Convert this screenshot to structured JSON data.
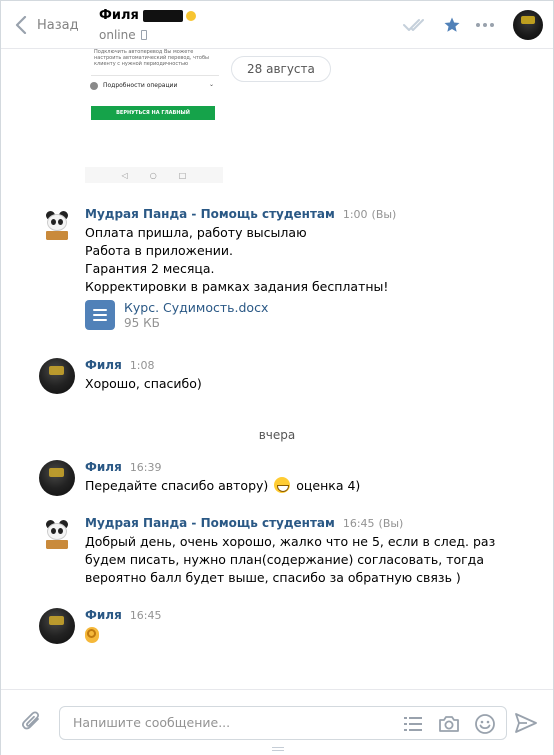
{
  "header": {
    "back_label": "Назад",
    "peer_name": "Филя",
    "peer_status": "online"
  },
  "history": {
    "date_pill": "28 августа",
    "screenshot": {
      "setting_text": "Подключить автоперевод Вы можете настроить автоматический перевод, чтобы клиенту с нужной периодичностью",
      "details_label": "Подробности операции",
      "button_label": "ВЕРНУТЬСЯ НА ГЛАВНЫЙ"
    },
    "day_separator": "вчера",
    "messages": [
      {
        "author": "Мудрая Панда - Помощь студентам",
        "time": "1:00",
        "you": "(Вы)",
        "lines": [
          "Оплата пришла, работу высылаю",
          "Работа в приложении.",
          "Гарантия 2 месяца.",
          "Корректировки в рамках задания бесплатны!"
        ],
        "doc_name": "Курс. Судимость.docx",
        "doc_size": "95 КБ"
      },
      {
        "author": "Филя",
        "time": "1:08",
        "text": "Хорошо, спасибо)"
      },
      {
        "author": "Филя",
        "time": "16:39",
        "text_before": "Передайте спасибо автору)",
        "text_after": "оценка 4)"
      },
      {
        "author": "Мудрая Панда - Помощь студентам",
        "time": "16:45",
        "you": "(Вы)",
        "lines": [
          "Добрый день, очень хорошо, жалко что не 5, если в след. раз",
          "будем писать, нужно план(содержание) согласовать, тогда",
          "вероятно балл будет выше, спасибо за обратную связь )"
        ]
      },
      {
        "author": "Филя",
        "time": "16:45"
      }
    ]
  },
  "composer": {
    "placeholder": "Напишите сообщение..."
  },
  "colors": {
    "link": "#2a5885",
    "accent": "#5181b8",
    "muted": "#939393"
  },
  "icons": [
    "back-arrow-icon",
    "double-check-icon",
    "star-icon",
    "more-icon",
    "phone-icon",
    "paperclip-icon",
    "template-list-icon",
    "camera-icon",
    "smile-icon",
    "send-icon",
    "document-icon"
  ]
}
